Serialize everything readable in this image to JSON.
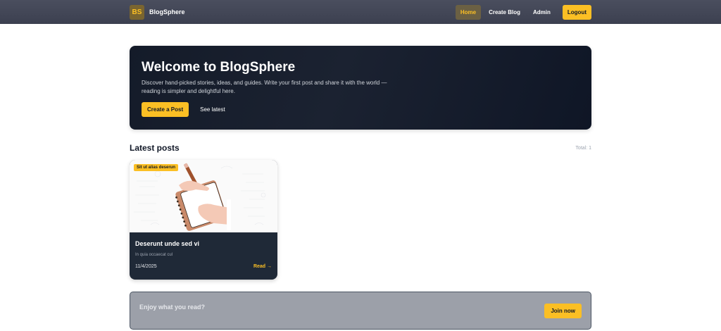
{
  "navbar": {
    "logo": "BS",
    "brand": "BlogSphere",
    "links": [
      {
        "label": "Home",
        "active": true
      },
      {
        "label": "Create Blog",
        "active": false
      },
      {
        "label": "Admin",
        "active": false
      }
    ],
    "logout_label": "Logout"
  },
  "hero": {
    "title": "Welcome to BlogSphere",
    "subtitle": "Discover hand-picked stories, ideas, and guides. Write your first post and share it with the world — reading is simpler and delightful here.",
    "primary_label": "Create a Post",
    "secondary_label": "See latest"
  },
  "section": {
    "title": "Latest posts",
    "count_label": "Total: 1"
  },
  "posts": [
    {
      "tag": "Sit ut alias deserun",
      "title": "Deserunt unde sed vi",
      "excerpt": "In quia occaecat cul",
      "date": "11/4/2025",
      "read_label": "Read →"
    }
  ],
  "cta": {
    "text": "Enjoy what you read?",
    "button_label": "Join now"
  },
  "colors": {
    "accent": "#fbbf24",
    "nav_bg": "#41455a",
    "hero_bg": "#141b29",
    "card_bg": "#1f2937",
    "cta_bg": "#9ca0a9"
  }
}
